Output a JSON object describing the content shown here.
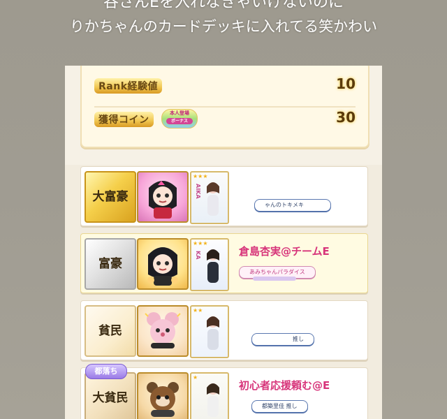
{
  "caption": {
    "line1": "谷さんEを入れなきゃいけないのに",
    "line2": "りかちゃんのカードデッキに入れてる笑かわい"
  },
  "result": {
    "rank_exp_label": "Rank経験値",
    "rank_exp_value": "10",
    "coins_label": "獲得コイン",
    "coins_value": "30",
    "bonus_badge_line1": "本人登場",
    "bonus_badge_line2": "ボーナス"
  },
  "players": [
    {
      "rank": "大富豪",
      "name": "",
      "tag": "ゃんのトキメキ",
      "card_vertical_text": "AIKA"
    },
    {
      "rank": "富豪",
      "name": "倉島杏実@チームE",
      "tag": "あみちゃんパラダイス",
      "card_vertical_text": "KA"
    },
    {
      "rank": "貧民",
      "name": "",
      "tag": "推し",
      "card_vertical_text": ""
    },
    {
      "rank": "大貧民",
      "name": "初心者応援頼む@E",
      "tag": "都築里佳 推し",
      "card_vertical_text": "",
      "demote_badge": "都落ち"
    }
  ],
  "colors": {
    "name_pink": "#d7347a",
    "panel_bg": "#f6f1e6",
    "highlight_row": "#fffbe2",
    "gold_badge": "#f5cf4a",
    "silver_badge": "#e2e2e2"
  }
}
